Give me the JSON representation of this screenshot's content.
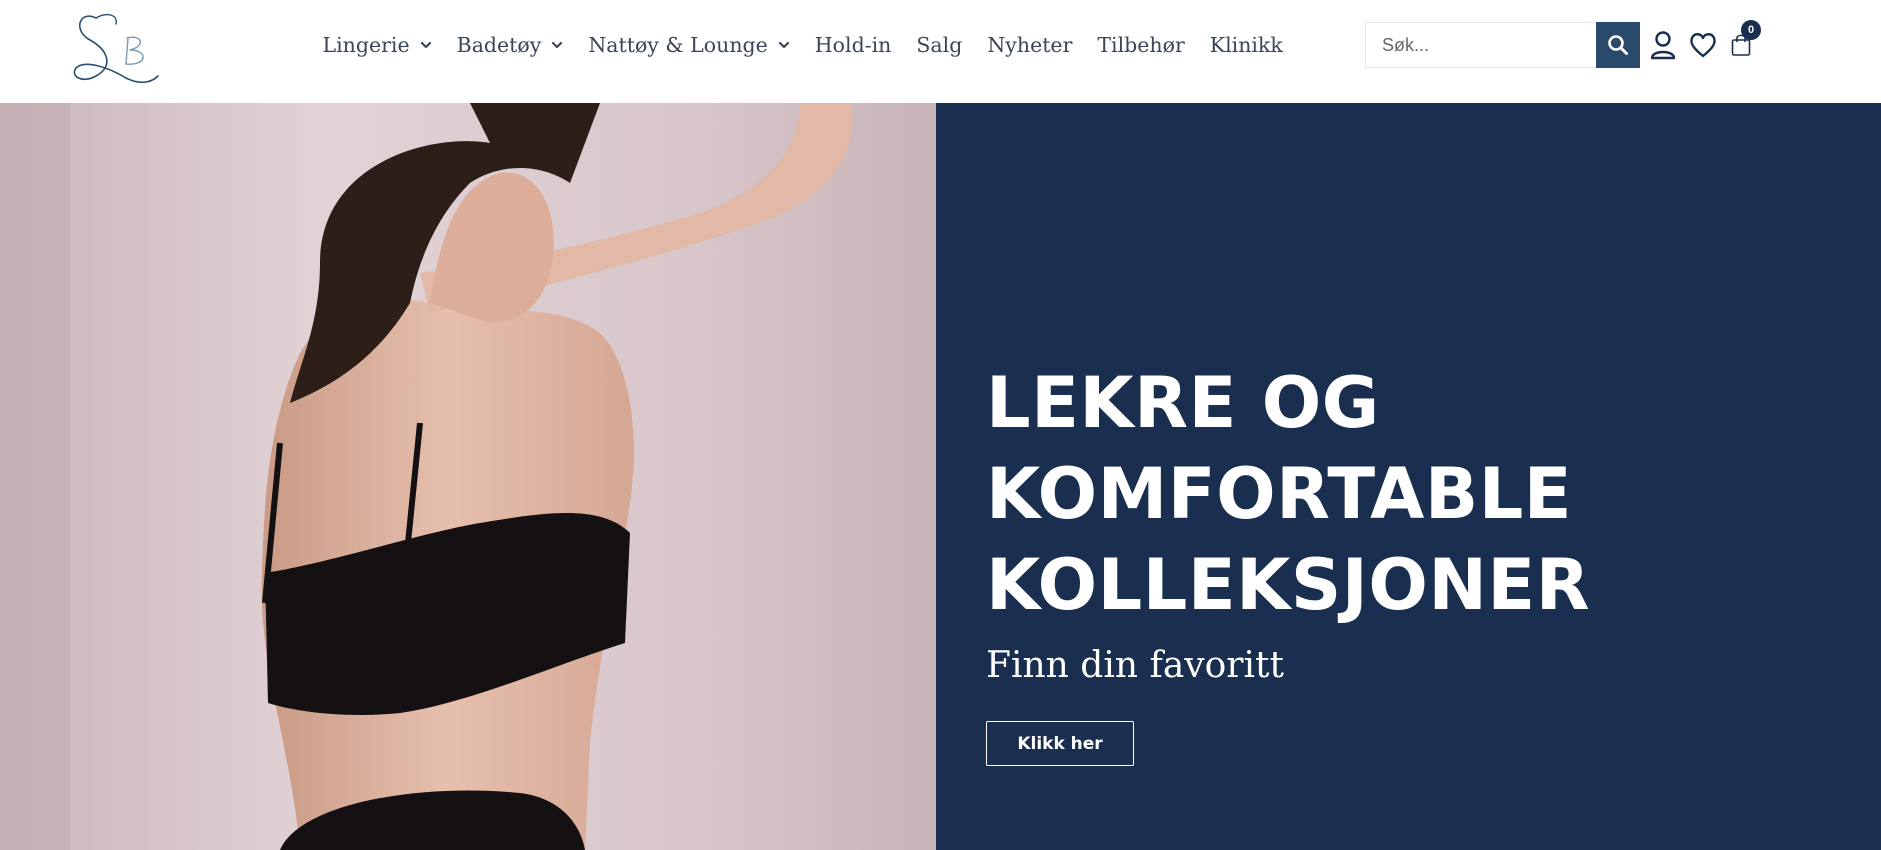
{
  "brand": {
    "logo_text": "SB",
    "logo_color": "#2a4f6e"
  },
  "nav": {
    "items": [
      {
        "label": "Lingerie",
        "has_dropdown": true
      },
      {
        "label": "Badetøy",
        "has_dropdown": true
      },
      {
        "label": "Nattøy & Lounge",
        "has_dropdown": true
      },
      {
        "label": "Hold-in",
        "has_dropdown": false
      },
      {
        "label": "Salg",
        "has_dropdown": false
      },
      {
        "label": "Nyheter",
        "has_dropdown": false
      },
      {
        "label": "Tilbehør",
        "has_dropdown": false
      },
      {
        "label": "Klinikk",
        "has_dropdown": false
      }
    ]
  },
  "search": {
    "placeholder": "Søk...",
    "value": "",
    "icon": "search-icon"
  },
  "header_icons": {
    "account": "user-icon",
    "wishlist": "heart-icon",
    "cart": "shopping-bag-icon",
    "cart_count": "0"
  },
  "hero": {
    "title_lines": [
      "LEKRE OG",
      "KOMFORTABLE",
      "KOLLEKSJONER"
    ],
    "subtitle": "Finn din favoritt",
    "cta_label": "Klikk her",
    "image_alt": "Model in black lace bra leaning against a pink wall"
  },
  "colors": {
    "panel_navy": "#1a2f4f",
    "search_button": "#2a4a6b",
    "nav_text": "#3b4656",
    "photo_wall": "#d6c4c9"
  }
}
